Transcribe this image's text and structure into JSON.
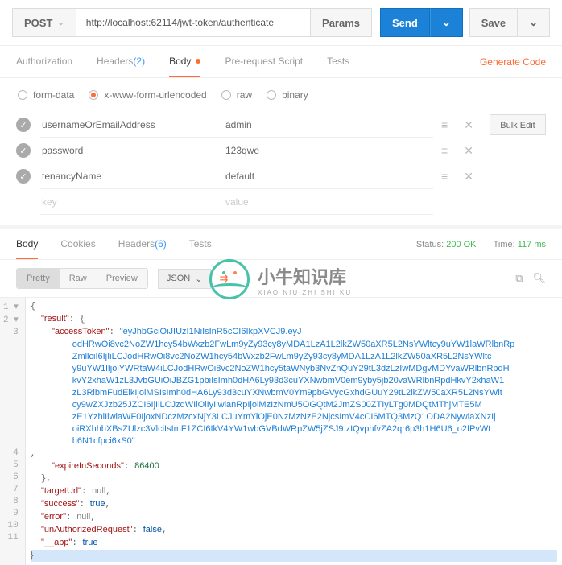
{
  "request": {
    "method": "POST",
    "url": "http://localhost:62114/jwt-token/authenticate",
    "params_label": "Params",
    "send_label": "Send",
    "save_label": "Save",
    "tabs": [
      {
        "label": "Authorization",
        "count": null,
        "active": false
      },
      {
        "label": "Headers",
        "count": "(2)",
        "active": false
      },
      {
        "label": "Body",
        "count": null,
        "active": true
      },
      {
        "label": "Pre-request Script",
        "count": null,
        "active": false
      },
      {
        "label": "Tests",
        "count": null,
        "active": false
      }
    ],
    "generate_code": "Generate Code",
    "body_types": [
      {
        "label": "form-data",
        "checked": false
      },
      {
        "label": "x-www-form-urlencoded",
        "checked": true
      },
      {
        "label": "raw",
        "checked": false
      },
      {
        "label": "binary",
        "checked": false
      }
    ],
    "bulk_edit": "Bulk Edit",
    "kv": [
      {
        "key": "usernameOrEmailAddress",
        "value": "admin",
        "checked": true
      },
      {
        "key": "password",
        "value": "123qwe",
        "checked": true
      },
      {
        "key": "tenancyName",
        "value": "default",
        "checked": true
      }
    ],
    "kv_placeholder_key": "key",
    "kv_placeholder_value": "value"
  },
  "response": {
    "tabs": [
      {
        "label": "Body",
        "active": true
      },
      {
        "label": "Cookies",
        "active": false
      },
      {
        "label": "Headers",
        "count": "(6)",
        "active": false
      },
      {
        "label": "Tests",
        "active": false
      }
    ],
    "status_label": "Status:",
    "status_value": "200 OK",
    "time_label": "Time:",
    "time_value": "117 ms",
    "view_modes": [
      {
        "label": "Pretty",
        "active": true
      },
      {
        "label": "Raw",
        "active": false
      },
      {
        "label": "Preview",
        "active": false
      }
    ],
    "format": "JSON",
    "json": {
      "result": {
        "accessToken": "eyJhbGciOiJIUzI1NiIsInR5cCI6IkpXVCJ9.eyJodHRwOi8vc2NoZW1hcy54bWxzb2FwLm9yZy93cy8yMDA1LzA1L2lkZW50aXR5L2NsYWltcy9uYW1laWRlbnRpZmllciI6IjIiLCJodHRwOi8vc2NoZW1hcy54bWxzb2FwLm9yZy93cy8yMDA1LzA1L2lkZW50aXR5L2NsYWltcy9uYW1lIjoiYWRtaW4iLCJodHRwOi8vc2NoZW1hcy5taWNyb3NvZnQuY29tL3dzLzIwMDgvMDYvaWRlbnRpdHkvY2xhaW1zL3JvbGUiOiJBZG1pbiIsImh0dHA6Ly93d3cuYXNwbmV0em9yby5jb20vaWRlbnRpdHkvY2xhaW1zL3RlbmFudElkIjoiMSIsImh0dHA6Ly93d3cuYXNwbmV0Ym9pbGVycGxhdGUuY29tL2lkZW50aXR5L2NsYWltcy9wZXJzb25JZCI6IjIiLCJzdWIiOiIyIiwianRpIjoiMzIzNmU5OGQtM2JmZS00ZTIyLTg0MDQtMThjMTE5MzE1YzhlIiwiaWF0IjoxNDczMzcxNjY3LCJuYmYiOjE0NzMzNzE2NjcsImV4cCI6MTQ3MzQ1ODA2NywiaXNzIjoiRXhhbXBsZUlzc3VlciIsImF1ZCI6IkV4YW1wbGVBdWRpZW5jZSJ9.zIQvphfvZA2qr6p3h1H6U6_o2fPvWth6N1cfpci6xS0",
        "expireInSeconds": 86400
      },
      "targetUrl": null,
      "success": true,
      "error": null,
      "unAuthorizedRequest": false,
      "__abp": true
    }
  },
  "watermark": {
    "cn": "小牛知识库",
    "en": "XIAO NIU ZHI SHI KU"
  }
}
